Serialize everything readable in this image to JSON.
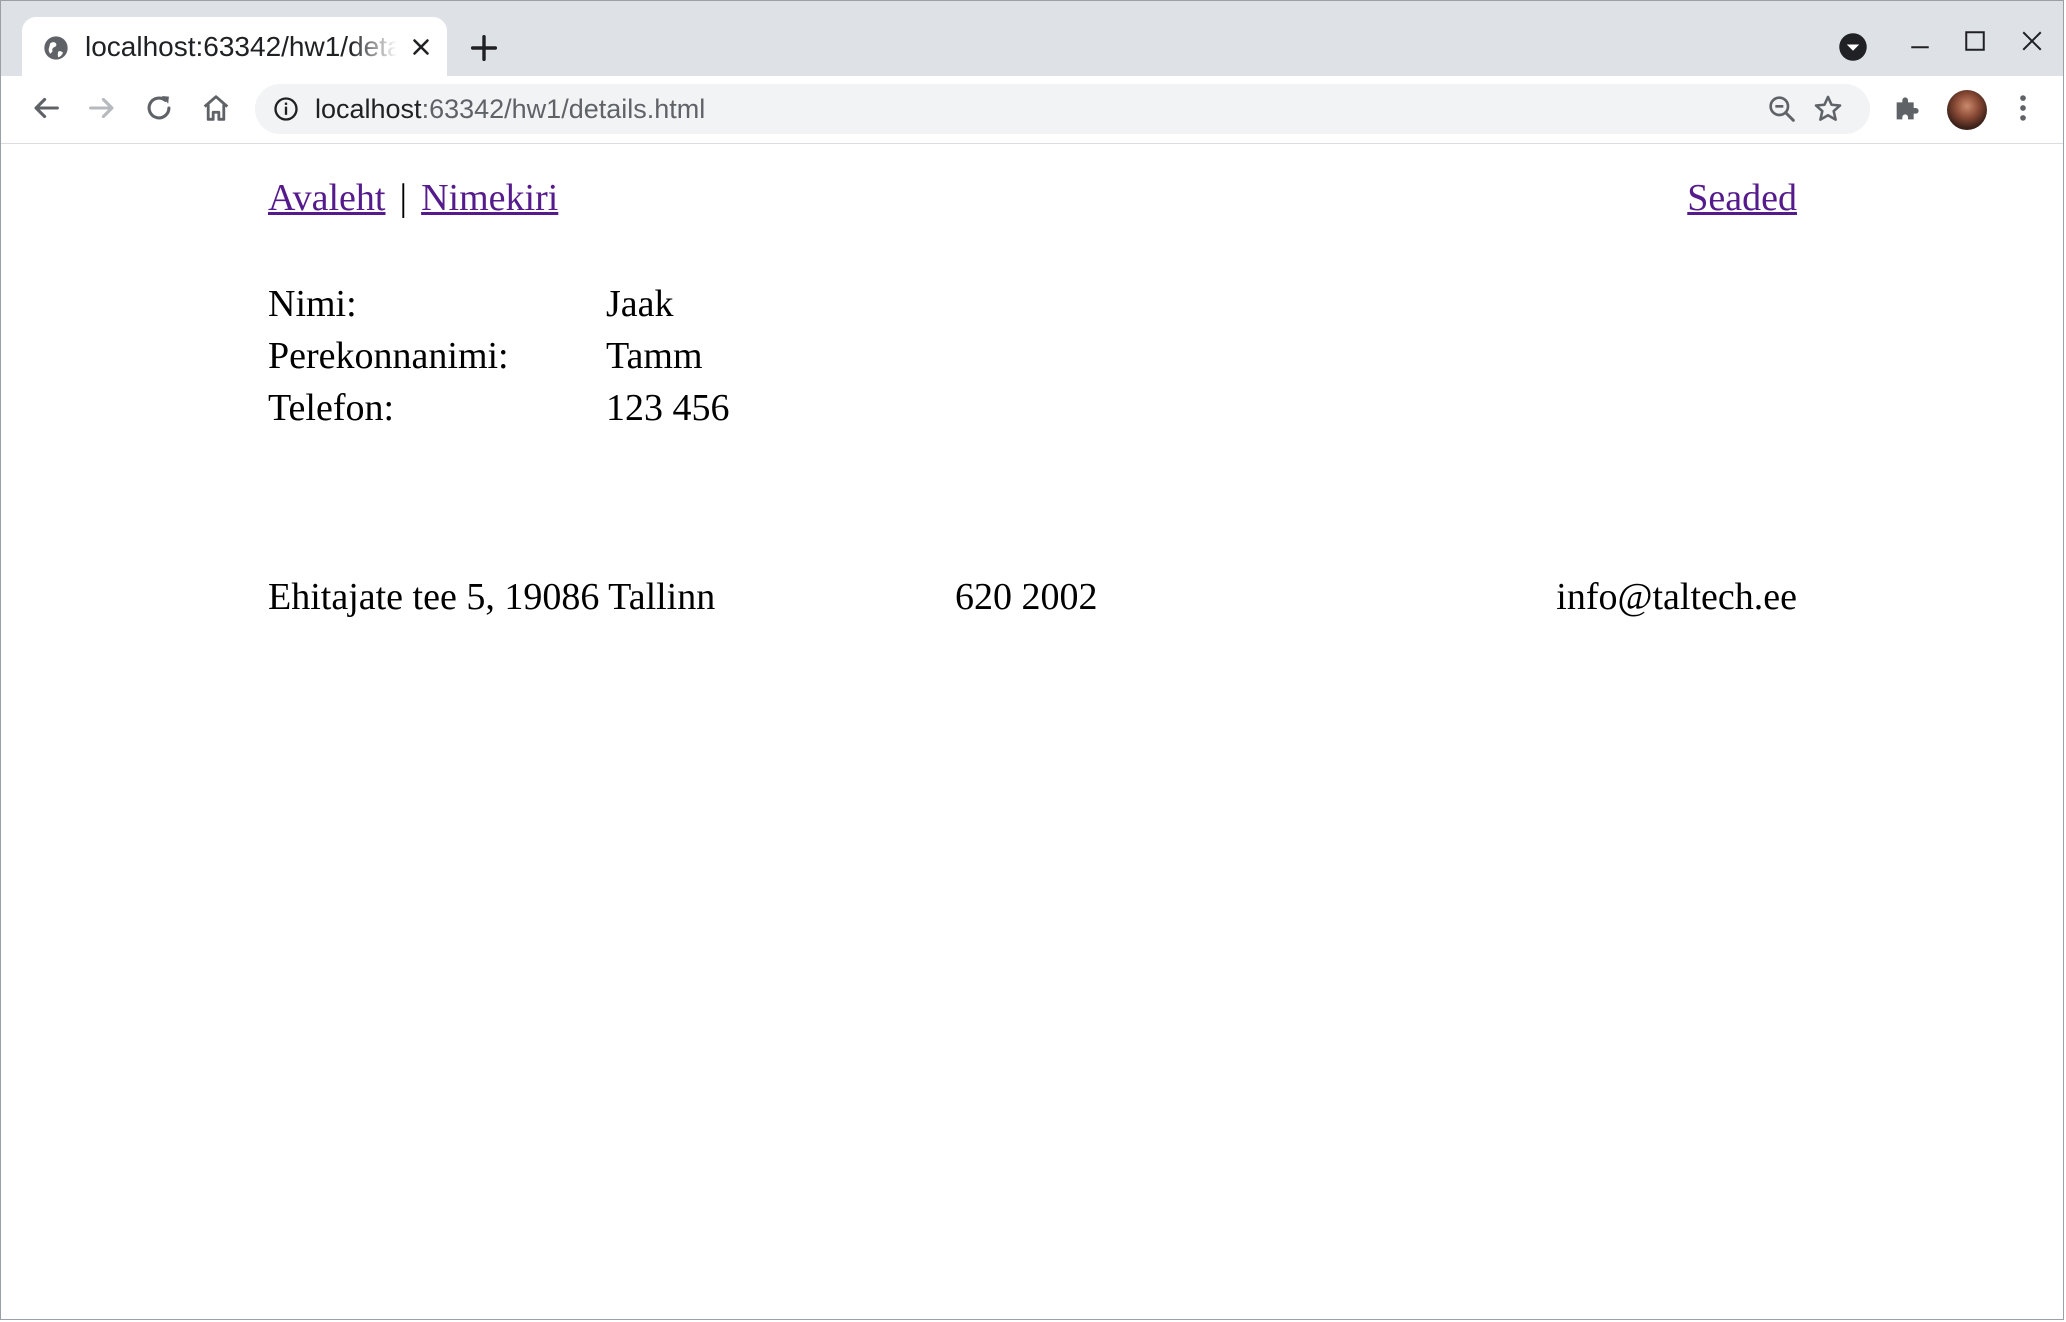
{
  "browser": {
    "tab_title": "localhost:63342/hw1/details.html",
    "url_host": "localhost",
    "url_path": ":63342/hw1/details.html",
    "icons": {
      "tab_favicon": "globe-icon",
      "tab_close": "close-icon",
      "new_tab": "plus-icon",
      "tab_search": "tab-search-icon",
      "back": "arrow-left-icon",
      "forward": "arrow-right-icon",
      "reload": "reload-icon",
      "home": "home-icon",
      "site_info": "info-icon",
      "zoom": "zoom-out-icon",
      "bookmark": "star-icon",
      "extensions": "puzzle-icon",
      "profile": "avatar",
      "menu": "kebab-menu-icon"
    }
  },
  "nav": {
    "home_link": "Avaleht",
    "separator": "|",
    "list_link": "Nimekiri",
    "settings_link": "Seaded",
    "link_color": "#551a8b"
  },
  "details": [
    {
      "label": "Nimi:",
      "value": "Jaak"
    },
    {
      "label": "Perekonnanimi:",
      "value": "Tamm"
    },
    {
      "label": "Telefon:",
      "value": "123 456"
    }
  ],
  "footer": {
    "address": "Ehitajate tee 5, 19086 Tallinn",
    "phone": "620 2002",
    "email": "info@taltech.ee"
  }
}
